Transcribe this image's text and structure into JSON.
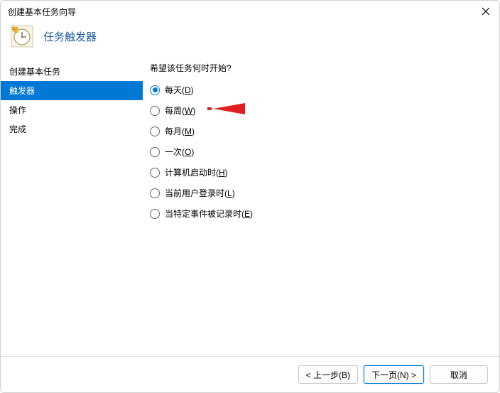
{
  "window": {
    "title": "创建基本任务向导"
  },
  "header": {
    "page_title": "任务触发器"
  },
  "sidebar": {
    "items": [
      {
        "label": "创建基本任务"
      },
      {
        "label": "触发器"
      },
      {
        "label": "操作"
      },
      {
        "label": "完成"
      }
    ]
  },
  "content": {
    "prompt": "希望该任务何时开始?",
    "options": [
      {
        "text": "每天(",
        "mnemonic": "D",
        "suffix": ")"
      },
      {
        "text": "每周(",
        "mnemonic": "W",
        "suffix": ")"
      },
      {
        "text": "每月(",
        "mnemonic": "M",
        "suffix": ")"
      },
      {
        "text": "一次(",
        "mnemonic": "O",
        "suffix": ")"
      },
      {
        "text": "计算机启动时(",
        "mnemonic": "H",
        "suffix": ")"
      },
      {
        "text": "当前用户登录时(",
        "mnemonic": "L",
        "suffix": ")"
      },
      {
        "text": "当特定事件被记录时(",
        "mnemonic": "E",
        "suffix": ")"
      }
    ]
  },
  "footer": {
    "back": "< 上一步(B)",
    "next": "下一页(N) >",
    "cancel": "取消"
  }
}
